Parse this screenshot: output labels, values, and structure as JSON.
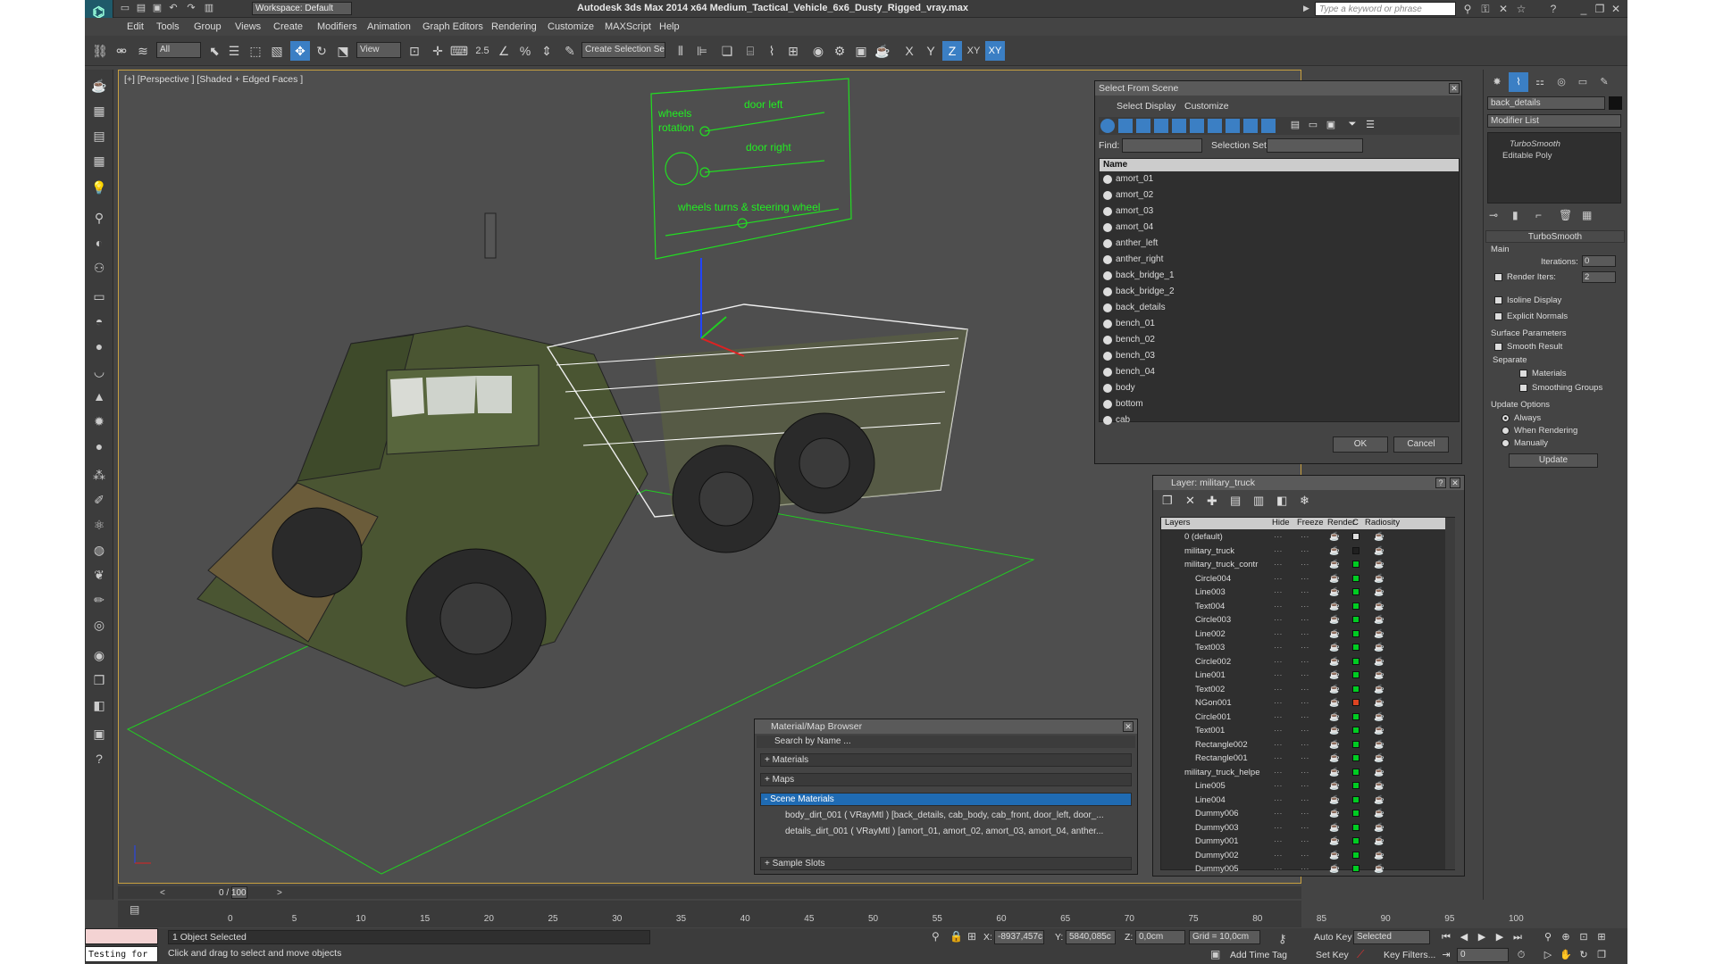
{
  "window": {
    "workspace": "Workspace: Default",
    "title": "Autodesk 3ds Max  2014 x64      Medium_Tactical_Vehicle_6x6_Dusty_Rigged_vray.max",
    "search_placeholder": "Type a keyword or phrase"
  },
  "menu": [
    "Edit",
    "Tools",
    "Group",
    "Views",
    "Create",
    "Modifiers",
    "Animation",
    "Graph Editors",
    "Rendering",
    "Customize",
    "MAXScript",
    "Help"
  ],
  "toolbar": {
    "filter": "All",
    "refcoord": "View",
    "angle_snap": "2.5",
    "selection_set": "Create Selection Se",
    "axis": [
      "X",
      "Y",
      "Z",
      "XY",
      "XY"
    ]
  },
  "viewport": {
    "label": "[+] [Perspective ] [Shaded + Edged Faces ]"
  },
  "control_panel": {
    "wheels_rotation": "wheels rotation",
    "door_left": "door left",
    "door_right": "door right",
    "wheels_turns": "wheels turns & steering wheel"
  },
  "select_scene": {
    "title": "Select From Scene",
    "menus": [
      "Select",
      "Display",
      "Customize"
    ],
    "find": "Find:",
    "selection_set": "Selection Set:",
    "col_name": "Name",
    "items": [
      "amort_01",
      "amort_02",
      "amort_03",
      "amort_04",
      "anther_left",
      "anther_right",
      "back_bridge_1",
      "back_bridge_2",
      "back_details",
      "bench_01",
      "bench_02",
      "bench_03",
      "bench_04",
      "body",
      "bottom",
      "cab"
    ],
    "ok": "OK",
    "cancel": "Cancel"
  },
  "layer": {
    "title": "Layer: military_truck",
    "cols": [
      "Layers",
      "Hide",
      "Freeze",
      "Render",
      "C",
      "Radiosity"
    ],
    "rows": [
      {
        "name": "0 (default)",
        "indent": 0,
        "color": "#dddddd"
      },
      {
        "name": "military_truck",
        "indent": 0,
        "color": "#202020"
      },
      {
        "name": "military_truck_contr",
        "indent": 0,
        "color": "#00cc22"
      },
      {
        "name": "Circle004",
        "indent": 1,
        "color": "#00cc22"
      },
      {
        "name": "Line003",
        "indent": 1,
        "color": "#00cc22"
      },
      {
        "name": "Text004",
        "indent": 1,
        "color": "#00cc22"
      },
      {
        "name": "Circle003",
        "indent": 1,
        "color": "#00cc22"
      },
      {
        "name": "Line002",
        "indent": 1,
        "color": "#00cc22"
      },
      {
        "name": "Text003",
        "indent": 1,
        "color": "#00cc22"
      },
      {
        "name": "Circle002",
        "indent": 1,
        "color": "#00cc22"
      },
      {
        "name": "Line001",
        "indent": 1,
        "color": "#00cc22"
      },
      {
        "name": "Text002",
        "indent": 1,
        "color": "#00cc22"
      },
      {
        "name": "NGon001",
        "indent": 1,
        "color": "#dd4422"
      },
      {
        "name": "Circle001",
        "indent": 1,
        "color": "#00cc22"
      },
      {
        "name": "Text001",
        "indent": 1,
        "color": "#00cc22"
      },
      {
        "name": "Rectangle002",
        "indent": 1,
        "color": "#00cc22"
      },
      {
        "name": "Rectangle001",
        "indent": 1,
        "color": "#00cc22"
      },
      {
        "name": "military_truck_helpe",
        "indent": 0,
        "color": "#00cc22"
      },
      {
        "name": "Line005",
        "indent": 1,
        "color": "#00cc22"
      },
      {
        "name": "Line004",
        "indent": 1,
        "color": "#00cc22"
      },
      {
        "name": "Dummy006",
        "indent": 1,
        "color": "#00cc22"
      },
      {
        "name": "Dummy003",
        "indent": 1,
        "color": "#00cc22"
      },
      {
        "name": "Dummy001",
        "indent": 1,
        "color": "#00cc22"
      },
      {
        "name": "Dummy002",
        "indent": 1,
        "color": "#00cc22"
      },
      {
        "name": "Dummy005",
        "indent": 1,
        "color": "#00cc22"
      }
    ]
  },
  "material_browser": {
    "title": "Material/Map Browser",
    "search": "Search by Name ...",
    "materials": "+ Materials",
    "maps": "+ Maps",
    "scene_materials": "- Scene Materials",
    "mat1": "body_dirt_001 ( VRayMtl ) [back_details, cab_body, cab_front, door_left, door_...",
    "mat2": "details_dirt_001  ( VRayMtl ) [amort_01, amort_02, amort_03, amort_04, anther...",
    "sample_slots": "+ Sample Slots"
  },
  "command_panel": {
    "object_name": "back_details",
    "modifier_list": "Modifier List",
    "stack": [
      "TurboSmooth",
      "Editable Poly"
    ],
    "rollout": "TurboSmooth",
    "main": "Main",
    "iterations_lbl": "Iterations:",
    "iterations": "0",
    "render_iters_lbl": "Render Iters:",
    "render_iters": "2",
    "isoline": "Isoline Display",
    "explicit": "Explicit Normals",
    "surface": "Surface Parameters",
    "smooth_result": "Smooth Result",
    "separate": "Separate",
    "materials": "Materials",
    "smoothing_groups": "Smoothing Groups",
    "update_options": "Update Options",
    "always": "Always",
    "when_rendering": "When Rendering",
    "manually": "Manually",
    "update": "Update"
  },
  "timeline": {
    "frame": "0 / 100",
    "ticks": [
      "0",
      "5",
      "10",
      "15",
      "20",
      "25",
      "30",
      "35",
      "40",
      "45",
      "50",
      "55",
      "60",
      "65",
      "70",
      "75",
      "80",
      "85",
      "90",
      "95",
      "100"
    ]
  },
  "status": {
    "maxscript": "Testing for :",
    "selected": "1 Object Selected",
    "prompt": "Click and drag to select and move objects",
    "x_lbl": "X:",
    "x": "-8937,457c",
    "y_lbl": "Y:",
    "y": "5840,085c",
    "z_lbl": "Z:",
    "z": "0,0cm",
    "grid": "Grid = 10,0cm",
    "auto_key": "Auto Key",
    "set_key": "Set Key",
    "key_mode": "Selected",
    "key_filters": "Key Filters...",
    "add_time_tag": "Add Time Tag",
    "frame": "0"
  }
}
